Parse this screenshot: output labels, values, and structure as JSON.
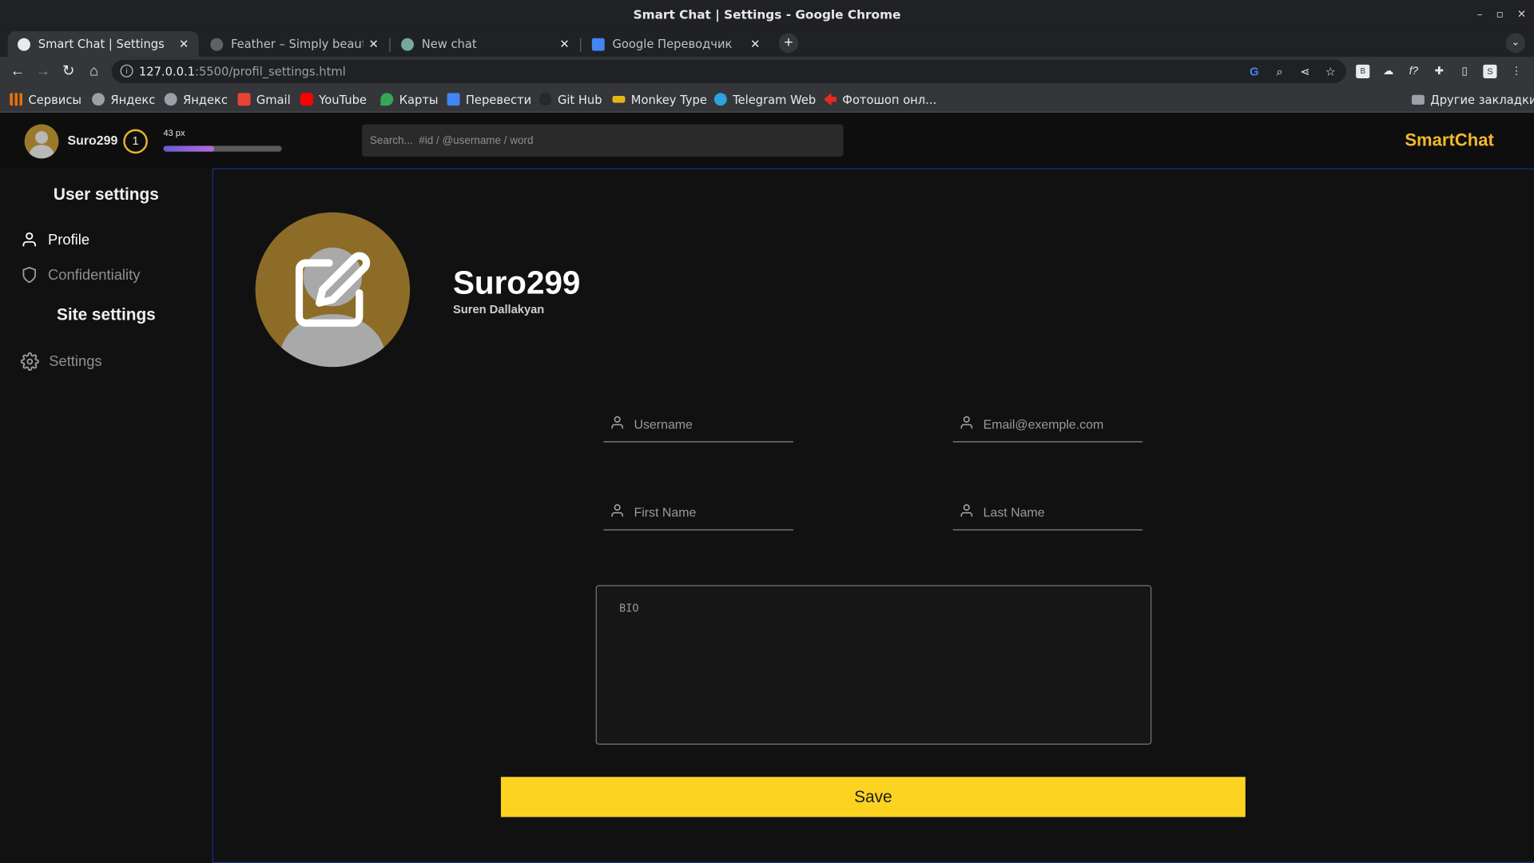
{
  "window": {
    "title": "Smart Chat | Settings - Google Chrome",
    "controls": [
      "–",
      "▫",
      "✕"
    ]
  },
  "tabs": [
    {
      "title": "Smart Chat | Settings",
      "active": true,
      "icon": "globe-icon"
    },
    {
      "title": "Feather – Simply beautiful",
      "active": false,
      "icon": "feather-icon"
    },
    {
      "title": "New chat",
      "active": false,
      "icon": "openai-icon"
    },
    {
      "title": "Google Переводчик",
      "active": false,
      "icon": "translate-icon"
    }
  ],
  "toolbar": {
    "url_host": "127.0.0.1",
    "url_rest": ":5500/profil_settings.html"
  },
  "bookmarks": [
    {
      "label": "Сервисы",
      "icon": "apps-grid-icon",
      "color": "#e8710a"
    },
    {
      "label": "Яндекс",
      "icon": "globe-icon",
      "color": "#9aa0a6"
    },
    {
      "label": "Яндекс",
      "icon": "globe-icon",
      "color": "#9aa0a6"
    },
    {
      "label": "Gmail",
      "icon": "gmail-icon",
      "color": "#ea4335"
    },
    {
      "label": "YouTube",
      "icon": "youtube-icon",
      "color": "#ff0000"
    },
    {
      "label": "Карты",
      "icon": "maps-icon",
      "color": "#34a853"
    },
    {
      "label": "Перевести",
      "icon": "translate-icon",
      "color": "#4285f4"
    },
    {
      "label": "Git Hub",
      "icon": "github-icon",
      "color": "#24292e"
    },
    {
      "label": "Monkey Type",
      "icon": "monkeytype-icon",
      "color": "#e2b714"
    },
    {
      "label": "Telegram Web",
      "icon": "telegram-icon",
      "color": "#2aa3df"
    },
    {
      "label": "Фотошоп онл...",
      "icon": "photoshop-icon",
      "color": "#e62b1e"
    }
  ],
  "other_bookmarks": "Другие закладки",
  "header": {
    "username": "Suro299",
    "level": "1",
    "xp_label": "43 px",
    "xp_progress": 0.43,
    "search_placeholder": "Search...  #id / @username / word",
    "brand": "SmartChat"
  },
  "sidebar": {
    "user_heading": "User settings",
    "profile_label": "Profile",
    "confidentiality_label": "Confidentiality",
    "site_heading": "Site settings",
    "settings_label": "Settings"
  },
  "profile": {
    "display_name": "Suro299",
    "full_name": "Suren Dallakyan"
  },
  "form": {
    "username_placeholder": "Username",
    "email_placeholder": "Email@exemple.com",
    "first_name_placeholder": "First Name",
    "last_name_placeholder": "Last Name",
    "bio_placeholder": "BIO",
    "save_label": "Save"
  },
  "colors": {
    "accent_yellow": "#fdd322",
    "brand_gold": "#f2b92a",
    "main_border": "#1b2f8a"
  }
}
